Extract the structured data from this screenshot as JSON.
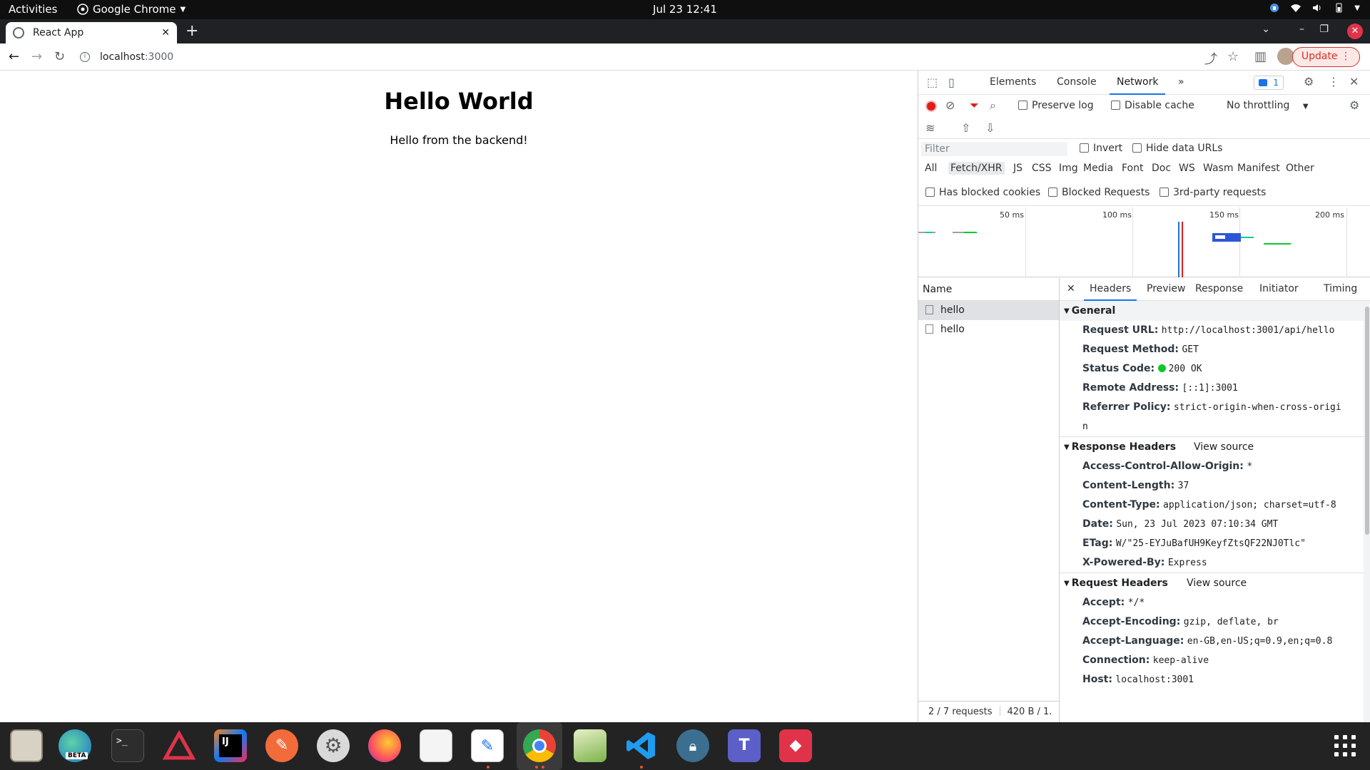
{
  "system": {
    "activities": "Activities",
    "app_name": "Google Chrome",
    "clock": "Jul 23  12:41"
  },
  "browser": {
    "tab_title": "React App",
    "url_host": "localhost",
    "url_port": ":3000",
    "update_label": "Update"
  },
  "page": {
    "heading": "Hello World",
    "message": "Hello from the backend!"
  },
  "devtools": {
    "tabs": [
      "Elements",
      "Console",
      "Network"
    ],
    "more": "»",
    "badge_count": "1",
    "preserve_log": "Preserve log",
    "disable_cache": "Disable cache",
    "throttling": "No throttling",
    "filter_placeholder": "Filter",
    "invert": "Invert",
    "hide_data_urls": "Hide data URLs",
    "types": [
      "All",
      "Fetch/XHR",
      "JS",
      "CSS",
      "Img",
      "Media",
      "Font",
      "Doc",
      "WS",
      "Wasm",
      "Manifest",
      "Other"
    ],
    "active_type": "Fetch/XHR",
    "has_blocked_cookies": "Has blocked cookies",
    "blocked_requests": "Blocked Requests",
    "third_party": "3rd-party requests",
    "overview_ticks": [
      "50 ms",
      "100 ms",
      "150 ms",
      "200 ms"
    ],
    "name_header": "Name",
    "requests": [
      "hello",
      "hello"
    ],
    "footer_requests": "2 / 7 requests",
    "footer_size": "420 B / 1.",
    "detail_tabs": [
      "Headers",
      "Preview",
      "Response",
      "Initiator",
      "Timing"
    ],
    "general": {
      "title": "General",
      "rows": [
        {
          "k": "Request URL:",
          "v": "http://localhost:3001/api/hello"
        },
        {
          "k": "Request Method:",
          "v": "GET"
        },
        {
          "k": "Status Code:",
          "v": "200 OK"
        },
        {
          "k": "Remote Address:",
          "v": "[::1]:3001"
        },
        {
          "k": "Referrer Policy:",
          "v": "strict-origin-when-cross-origi"
        },
        {
          "k": "",
          "v": "n"
        }
      ]
    },
    "response_headers": {
      "title": "Response Headers",
      "view_source": "View source",
      "rows": [
        {
          "k": "Access-Control-Allow-Origin:",
          "v": "*"
        },
        {
          "k": "Content-Length:",
          "v": "37"
        },
        {
          "k": "Content-Type:",
          "v": "application/json; charset=utf-8"
        },
        {
          "k": "Date:",
          "v": "Sun, 23 Jul 2023 07:10:34 GMT"
        },
        {
          "k": "ETag:",
          "v": "W/\"25-EYJuBafUH9KeyfZtsQF22NJ0Tlc\""
        },
        {
          "k": "X-Powered-By:",
          "v": "Express"
        }
      ]
    },
    "request_headers": {
      "title": "Request Headers",
      "view_source": "View source",
      "rows": [
        {
          "k": "Accept:",
          "v": "*/*"
        },
        {
          "k": "Accept-Encoding:",
          "v": "gzip, deflate, br"
        },
        {
          "k": "Accept-Language:",
          "v": "en-GB,en-US;q=0.9,en;q=0.8"
        },
        {
          "k": "Connection:",
          "v": "keep-alive"
        },
        {
          "k": "Host:",
          "v": "localhost:3001"
        }
      ]
    }
  },
  "dock": {
    "beta_label": "BETA"
  }
}
